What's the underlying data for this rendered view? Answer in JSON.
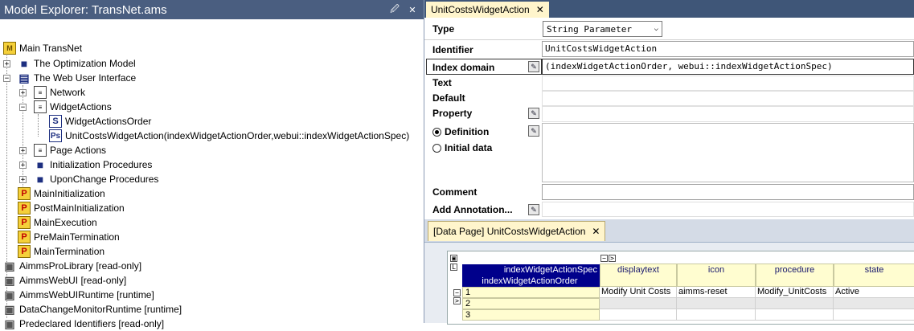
{
  "explorer": {
    "title": "Model Explorer: TransNet.ams",
    "pin_icon": "pin-icon",
    "close_icon": "close-icon",
    "nodes": [
      "Main TransNet",
      "The Optimization Model",
      "The Web User Interface",
      "Network",
      "WidgetActions",
      "WidgetActionsOrder",
      "UnitCostsWidgetAction(indexWidgetActionOrder,webui::indexWidgetActionSpec)",
      "Page Actions",
      "Initialization Procedures",
      "UponChange Procedures",
      "MainInitialization",
      "PostMainInitialization",
      "MainExecution",
      "PreMainTermination",
      "MainTermination",
      "AimmsProLibrary [read-only]",
      "AimmsWebUI [read-only]",
      "AimmsWebUIRuntime [runtime]",
      "DataChangeMonitorRuntime [runtime]",
      "Predeclared Identifiers [read-only]"
    ]
  },
  "attr": {
    "tab_label": "UnitCostsWidgetAction",
    "labels": {
      "type": "Type",
      "identifier": "Identifier",
      "index_domain": "Index domain",
      "text": "Text",
      "default": "Default",
      "property": "Property",
      "definition": "Definition",
      "initial_data": "Initial data",
      "comment": "Comment",
      "add_annotation": "Add Annotation..."
    },
    "type_value": "String Parameter",
    "identifier_value": "UnitCostsWidgetAction",
    "index_domain_value": "(indexWidgetActionOrder, webui::indexWidgetActionSpec)"
  },
  "datapage": {
    "tab_label": "[Data Page] UnitCostsWidgetAction",
    "row_index_header_1": "indexWidgetActionSpec",
    "row_index_header_2": "indexWidgetActionOrder",
    "columns": [
      "displaytext",
      "icon",
      "procedure",
      "state"
    ],
    "rows": [
      {
        "key": "1",
        "values": [
          "Modify Unit Costs",
          "aimms-reset",
          "Modify_UnitCosts",
          "Active"
        ]
      },
      {
        "key": "2",
        "values": [
          "",
          "",
          "",
          ""
        ]
      },
      {
        "key": "3",
        "values": [
          "",
          "",
          "",
          ""
        ]
      }
    ]
  },
  "colors": {
    "title_bar": "#4a5e80",
    "active_tab": "#fff5cc",
    "header_blue": "#00008b",
    "header_yellow": "#fffdd0"
  }
}
